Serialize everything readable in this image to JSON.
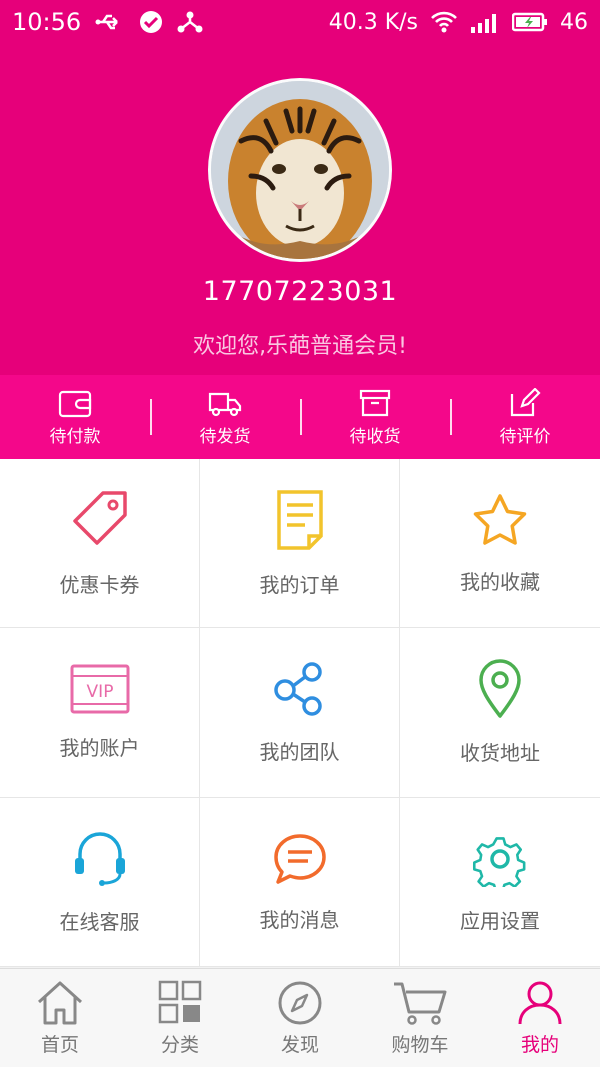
{
  "status_bar": {
    "time": "10:56",
    "speed": "40.3 K/s",
    "signal": "46",
    "icons": [
      "usb-icon",
      "check-circle-icon",
      "share-icon",
      "wifi-icon",
      "cellular-signal-icon",
      "battery-charging-icon"
    ]
  },
  "profile": {
    "avatar": "tiger-avatar",
    "phone": "17707223031",
    "welcome": "欢迎您,乐葩普通会员!"
  },
  "orders": [
    {
      "label": "待付款",
      "icon": "wallet-icon"
    },
    {
      "label": "待发货",
      "icon": "truck-icon"
    },
    {
      "label": "待收货",
      "icon": "box-icon"
    },
    {
      "label": "待评价",
      "icon": "edit-icon"
    }
  ],
  "grid": [
    {
      "label": "优惠卡券",
      "icon": "tag-icon",
      "color": "#e8496b"
    },
    {
      "label": "我的订单",
      "icon": "document-icon",
      "color": "#f2c42c"
    },
    {
      "label": "我的收藏",
      "icon": "star-icon",
      "color": "#f5a623"
    },
    {
      "label": "我的账户",
      "icon": "vip-icon",
      "color": "#e86aa8"
    },
    {
      "label": "我的团队",
      "icon": "share-nodes-icon",
      "color": "#2f8ee0"
    },
    {
      "label": "收货地址",
      "icon": "location-pin-icon",
      "color": "#4caf50"
    },
    {
      "label": "在线客服",
      "icon": "headset-icon",
      "color": "#1aa5d8"
    },
    {
      "label": "我的消息",
      "icon": "chat-bubble-icon",
      "color": "#f26b2c"
    },
    {
      "label": "应用设置",
      "icon": "gear-icon",
      "color": "#1fb8a8"
    }
  ],
  "nav": [
    {
      "label": "首页",
      "icon": "home-icon"
    },
    {
      "label": "分类",
      "icon": "category-grid-icon"
    },
    {
      "label": "发现",
      "icon": "compass-icon"
    },
    {
      "label": "购物车",
      "icon": "cart-icon"
    },
    {
      "label": "我的",
      "icon": "user-icon",
      "active": true
    }
  ],
  "colors": {
    "brand": "#e6007a",
    "strip": "#f4078a",
    "active": "#e6007a"
  }
}
